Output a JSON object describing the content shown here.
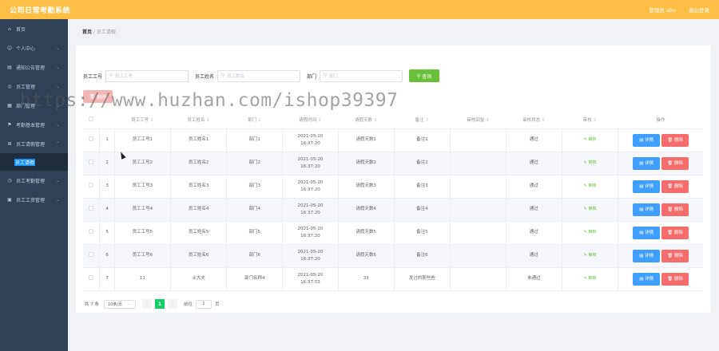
{
  "app": {
    "title": "公司日常考勤系统",
    "admin_label": "管理员 abo",
    "logout_label": "退出登录"
  },
  "sidebar": {
    "items": [
      {
        "label": "首页",
        "icon": "home-icon",
        "expandable": false
      },
      {
        "label": "个人中心",
        "icon": "user-icon",
        "expandable": true
      },
      {
        "label": "通知公告管理",
        "icon": "notice-icon",
        "expandable": true
      },
      {
        "label": "员工管理",
        "icon": "staff-icon",
        "expandable": true
      },
      {
        "label": "部门管理",
        "icon": "dept-icon",
        "expandable": true
      },
      {
        "label": "考勤基本管理",
        "icon": "attendance-icon",
        "expandable": true
      },
      {
        "label": "员工请假管理",
        "icon": "leave-icon",
        "expandable": true,
        "open": true
      },
      {
        "label": "员工考勤管理",
        "icon": "clock-icon",
        "expandable": true
      },
      {
        "label": "员工工资管理",
        "icon": "salary-icon",
        "expandable": true
      }
    ],
    "active_sub": "员工请假"
  },
  "breadcrumb": {
    "home": "首页",
    "sep": "/",
    "current": "员工请假"
  },
  "filters": {
    "emp_no_label": "员工工号",
    "emp_no_placeholder": "员工工号",
    "emp_name_label": "员工姓名",
    "emp_name_placeholder": "员工姓名",
    "dept_label": "部门",
    "dept_placeholder": "部门",
    "search_label": "查询",
    "delete_label": "删除"
  },
  "table": {
    "headers": [
      "",
      "",
      "员工工号",
      "员工姓名",
      "部门",
      "请假时间",
      "请假天数",
      "备注",
      "审核回复",
      "审核状态",
      "审核",
      "操作"
    ],
    "rows": [
      {
        "idx": "1",
        "no": "员工工号1",
        "name": "员工姓名1",
        "dept": "部门1",
        "time": "2021-05-20 16:37:20",
        "days": "请假天数1",
        "note": "备注1",
        "reply": "",
        "status": "通过",
        "review": "审核"
      },
      {
        "idx": "2",
        "no": "员工工号2",
        "name": "员工姓名2",
        "dept": "部门2",
        "time": "2021-05-20 16:37:20",
        "days": "请假天数2",
        "note": "备注2",
        "reply": "",
        "status": "通过",
        "review": "审核"
      },
      {
        "idx": "3",
        "no": "员工工号3",
        "name": "员工姓名3",
        "dept": "部门3",
        "time": "2021-05-20 16:37:20",
        "days": "请假天数3",
        "note": "备注3",
        "reply": "",
        "status": "通过",
        "review": "审核"
      },
      {
        "idx": "4",
        "no": "员工工号4",
        "name": "员工姓名4",
        "dept": "部门4",
        "time": "2021-05-20 16:37:20",
        "days": "请假天数4",
        "note": "备注4",
        "reply": "",
        "status": "通过",
        "review": "审核"
      },
      {
        "idx": "5",
        "no": "员工工号5",
        "name": "员工姓名5",
        "dept": "部门5",
        "time": "2021-05-20 16:37:20",
        "days": "请假天数5",
        "note": "备注5",
        "reply": "",
        "status": "通过",
        "review": "审核"
      },
      {
        "idx": "6",
        "no": "员工工号6",
        "name": "员工姓名6",
        "dept": "部门6",
        "time": "2021-05-20 16:37:20",
        "days": "请假天数6",
        "note": "备注6",
        "reply": "",
        "status": "通过",
        "review": "审核"
      },
      {
        "idx": "7",
        "no": "11",
        "name": "士大夫",
        "dept": "部门名称4",
        "time": "2021-05-20 16:37:53",
        "days": "33",
        "note": "发过的那些些",
        "reply": "",
        "status": "未通过",
        "review": "审核"
      }
    ],
    "detail_label": "详情",
    "delete_label": "删除"
  },
  "pagination": {
    "total_label": "共 7 条",
    "page_size": "10条/页",
    "current_page": "1",
    "goto_label": "前往",
    "goto_value": "1",
    "page_unit": "页"
  },
  "watermark": "https://www.huzhan.com/ishop39397",
  "colors": {
    "topbar": "#ffbf46",
    "sidebar": "#304156",
    "search": "#67c23a",
    "detail": "#409eff",
    "delete": "#f56c6c",
    "pager_active": "#13ce66"
  }
}
